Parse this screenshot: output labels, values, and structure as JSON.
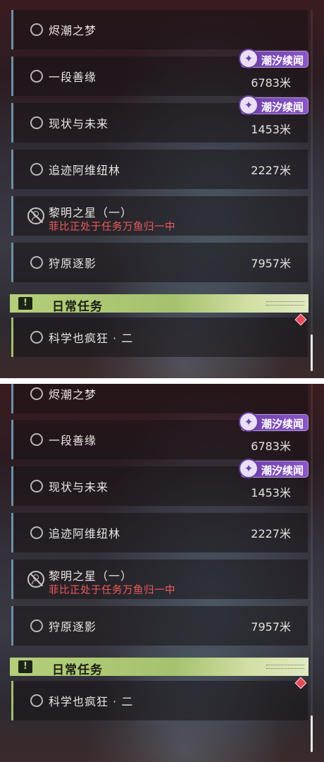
{
  "screens": [
    {
      "quests": [
        {
          "title": "烬潮之梦",
          "distance": "",
          "badge": ""
        },
        {
          "title": "一段善缘",
          "distance": "6783米",
          "badge": "潮汐续闻"
        },
        {
          "title": "现状与未来",
          "distance": "1453米",
          "badge": "潮汐续闻"
        },
        {
          "title": "追迹阿维纽林",
          "distance": "2227米",
          "badge": ""
        },
        {
          "title": "黎明之星（一）",
          "warning": "菲比正处于任务万鱼归一中",
          "locked": true
        },
        {
          "title": "狩原逐影",
          "distance": "7957米",
          "badge": ""
        }
      ],
      "section": {
        "label": "日常任务",
        "icon": "exclamation-icon"
      },
      "daily": [
        {
          "title": "科学也疯狂 · 二"
        }
      ]
    },
    {
      "quests": [
        {
          "title": "烬潮之梦",
          "distance": "",
          "badge": ""
        },
        {
          "title": "一段善缘",
          "distance": "6783米",
          "badge": "潮汐续闻"
        },
        {
          "title": "现状与未来",
          "distance": "1453米",
          "badge": "潮汐续闻"
        },
        {
          "title": "追迹阿维纽林",
          "distance": "2227米",
          "badge": ""
        },
        {
          "title": "黎明之星（一）",
          "warning": "菲比正处于任务万鱼归一中",
          "locked": true
        },
        {
          "title": "狩原逐影",
          "distance": "7957米",
          "badge": ""
        }
      ],
      "section": {
        "label": "日常任务",
        "icon": "exclamation-icon"
      },
      "daily": [
        {
          "title": "科学也疯狂 · 二"
        }
      ]
    }
  ],
  "colors": {
    "accent_quest": "#6e8fa8",
    "accent_daily": "#9fbf6a",
    "warning": "#ef5b5b",
    "badge": "#7a4bb8"
  }
}
